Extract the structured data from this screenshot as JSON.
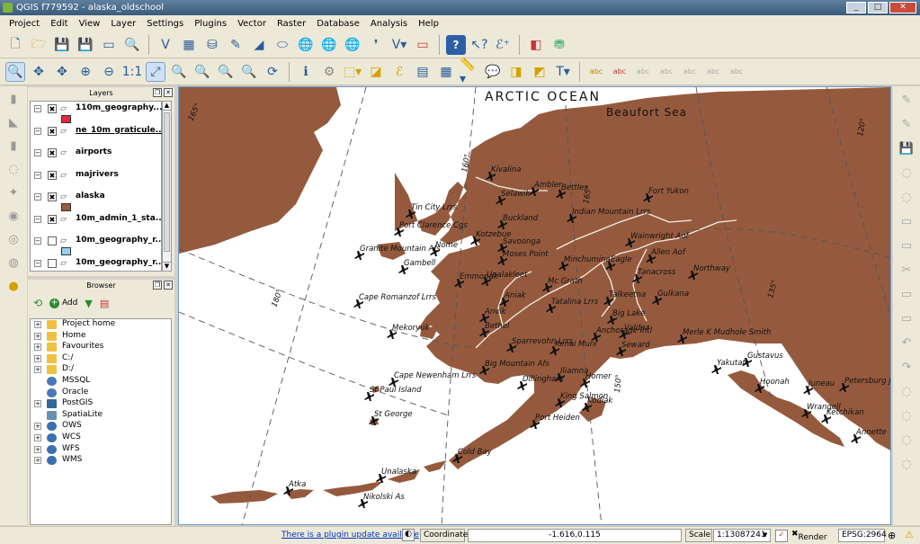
{
  "window": {
    "title": "QGIS f779592 - alaska_oldschool",
    "minimize": "_",
    "maximize": "□",
    "close": "✕"
  },
  "menu": [
    "Project",
    "Edit",
    "View",
    "Layer",
    "Settings",
    "Plugins",
    "Vector",
    "Raster",
    "Database",
    "Analysis",
    "Help"
  ],
  "layers_panel": {
    "title": "Layers",
    "items": [
      {
        "name": "110m_geography...",
        "checked": true,
        "color": "#e8263c"
      },
      {
        "name": "ne_10m_graticule...",
        "checked": true,
        "underline": true
      },
      {
        "name": "airports",
        "checked": true
      },
      {
        "name": "majrivers",
        "checked": true
      },
      {
        "name": "alaska",
        "checked": true,
        "color": "#9a5a3c"
      },
      {
        "name": "10m_admin_1_sta...",
        "checked": true
      },
      {
        "name": "10m_geography_r...",
        "checked": false,
        "color": "#8fd3e8"
      },
      {
        "name": "10m_geography_r...",
        "checked": false
      }
    ]
  },
  "browser_panel": {
    "title": "Browser",
    "add_label": "Add",
    "items": [
      {
        "label": "Project home",
        "icon": "folder"
      },
      {
        "label": "Home",
        "icon": "folder"
      },
      {
        "label": "Favourites",
        "icon": "folder"
      },
      {
        "label": "C:/",
        "icon": "folder"
      },
      {
        "label": "D:/",
        "icon": "folder"
      },
      {
        "label": "MSSQL",
        "icon": "db"
      },
      {
        "label": "Oracle",
        "icon": "db"
      },
      {
        "label": "PostGIS",
        "icon": "elephant"
      },
      {
        "label": "SpatiaLite",
        "icon": "feather"
      },
      {
        "label": "OWS",
        "icon": "globe"
      },
      {
        "label": "WCS",
        "icon": "globe"
      },
      {
        "label": "WFS",
        "icon": "globe"
      },
      {
        "label": "WMS",
        "icon": "globe"
      }
    ]
  },
  "map": {
    "colors": {
      "land": "#955a3e",
      "water": "#ffffff",
      "rivers": "#f5efe6",
      "graticule": "#555555"
    },
    "water_labels": [
      "ARCTIC OCEAN",
      "Beaufort Sea"
    ],
    "graticule_labels": [
      "165°",
      "160°",
      "180°",
      "165°",
      "150°",
      "135°",
      "120°"
    ],
    "places": [
      "Kivalina",
      "Ambler",
      "Bettles",
      "Fort Yukon",
      "Tin City Lrrs",
      "Selawik",
      "Buckland",
      "Indian Mountain Lrrs",
      "Port Clarence Cgs",
      "Kotzebue",
      "Wainwright Aof",
      "Nome",
      "Granite Mountain Afs",
      "Gambell",
      "Savoonga",
      "Moses Point",
      "Minchumina",
      "Eagle",
      "Allen Aof",
      "Tanacross",
      "Northway",
      "Emmonak",
      "Unalakleet",
      "Mc Grath",
      "Cape Romanzof Lrrs",
      "Aniak",
      "Tatalina Lrrs",
      "Talkeetna",
      "Gulkana",
      "Big Lake",
      "Anvik",
      "Anchorage Intl",
      "Valdez",
      "Merle K Mudhole Smith",
      "Mekoryuk",
      "Bethel",
      "Sparrevohn Lrrs",
      "Kenai Muni",
      "Seward",
      "Yakutat",
      "Gustavus",
      "Cape Newenham Lrrs",
      "Big Mountain Afs",
      "Dillingham",
      "Iliamna",
      "Homer",
      "Hoonah",
      "Juneau",
      "Petersburg James",
      "St Paul Island",
      "King Salmon",
      "Kodiak",
      "St George",
      "Port Heiden",
      "Cold Bay",
      "Wrangell",
      "Ketchikan",
      "Annette",
      "Unalaska",
      "Atka",
      "Nikolski As"
    ]
  },
  "status": {
    "plugin_update": "There is a plugin update available",
    "coordinate_label": "Coordinate:",
    "coordinate_value": "-1.616,0.115",
    "scale_label": "Scale",
    "scale_value": "1:13087241",
    "render_label": "Render",
    "epsg": "EPSG:2964"
  }
}
